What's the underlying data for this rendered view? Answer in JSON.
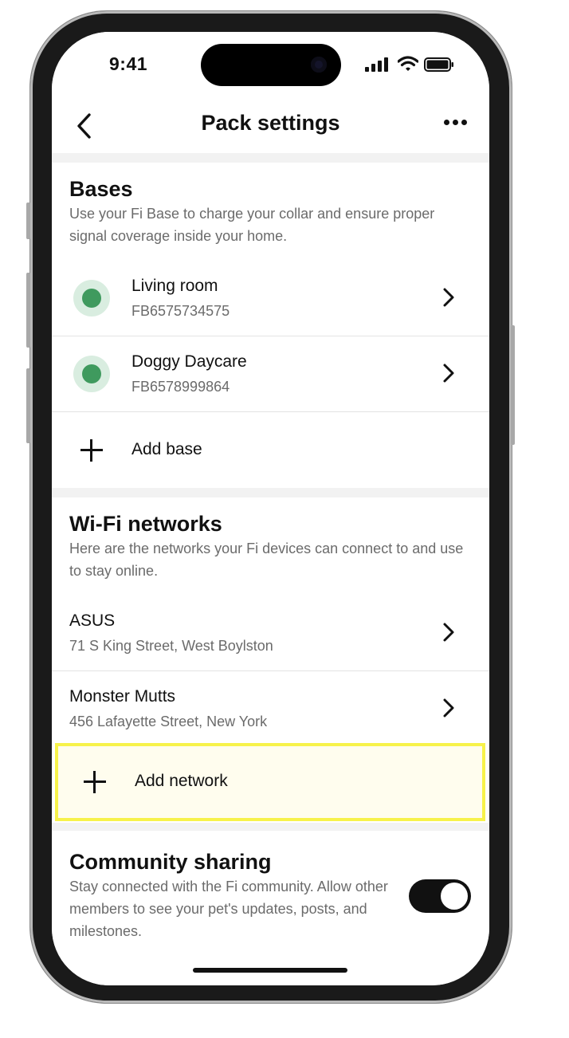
{
  "status_bar": {
    "time": "9:41"
  },
  "nav": {
    "title": "Pack settings"
  },
  "bases": {
    "title": "Bases",
    "description": "Use your Fi Base to charge your collar and ensure proper signal coverage inside your home.",
    "items": [
      {
        "name": "Living room",
        "id": "FB6575734575",
        "status_color": "#3f9a5e"
      },
      {
        "name": "Doggy Daycare",
        "id": "FB6578999864",
        "status_color": "#3f9a5e"
      }
    ],
    "add_label": "Add base"
  },
  "wifi": {
    "title": "Wi-Fi networks",
    "description": "Here are the networks your Fi devices can connect to and use to stay online.",
    "items": [
      {
        "name": "ASUS",
        "address": "71 S King Street, West Boylston"
      },
      {
        "name": "Monster Mutts",
        "address": "456 Lafayette Street, New York"
      }
    ],
    "add_label": "Add network"
  },
  "community": {
    "title": "Community sharing",
    "description": "Stay connected with the Fi community. Allow other members to see your pet's updates, posts, and milestones.",
    "toggle_on": true
  },
  "colors": {
    "highlight_border": "#f7f24a",
    "highlight_fill": "#fffdee",
    "status_dot": "#3f9a5e"
  }
}
